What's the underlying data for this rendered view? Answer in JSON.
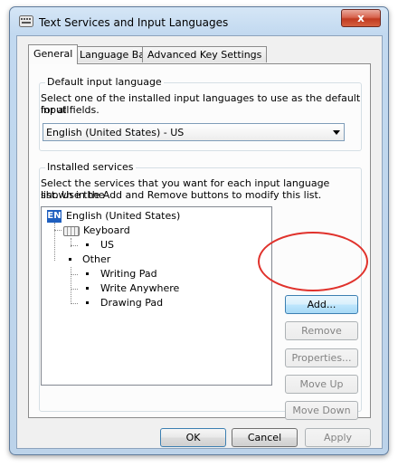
{
  "window": {
    "title": "Text Services and Input Languages",
    "close_label": "x"
  },
  "tabs": [
    {
      "label": "General"
    },
    {
      "label": "Language Bar"
    },
    {
      "label": "Advanced Key Settings"
    }
  ],
  "default_input": {
    "group_label": "Default input language",
    "description_line1": "Select one of the installed input languages to use as the default for all",
    "description_line2": "input fields.",
    "selected": "English (United States) - US"
  },
  "installed": {
    "group_label": "Installed services",
    "description_line1": "Select the services that you want for each input language shown in the",
    "description_line2": "list. Use the Add and Remove buttons to modify this list.",
    "tree": {
      "language_badge": "EN",
      "language": "English (United States)",
      "keyboard": "Keyboard",
      "keyboard_layout": "US",
      "other": "Other",
      "services": [
        "Writing Pad",
        "Write Anywhere",
        "Drawing Pad"
      ]
    },
    "buttons": {
      "add": "Add...",
      "remove": "Remove",
      "properties": "Properties...",
      "move_up": "Move Up",
      "move_down": "Move Down"
    }
  },
  "footer": {
    "ok": "OK",
    "cancel": "Cancel",
    "apply": "Apply"
  },
  "colors": {
    "annotation": "#e0322c",
    "language_badge": "#1f5fbf"
  }
}
